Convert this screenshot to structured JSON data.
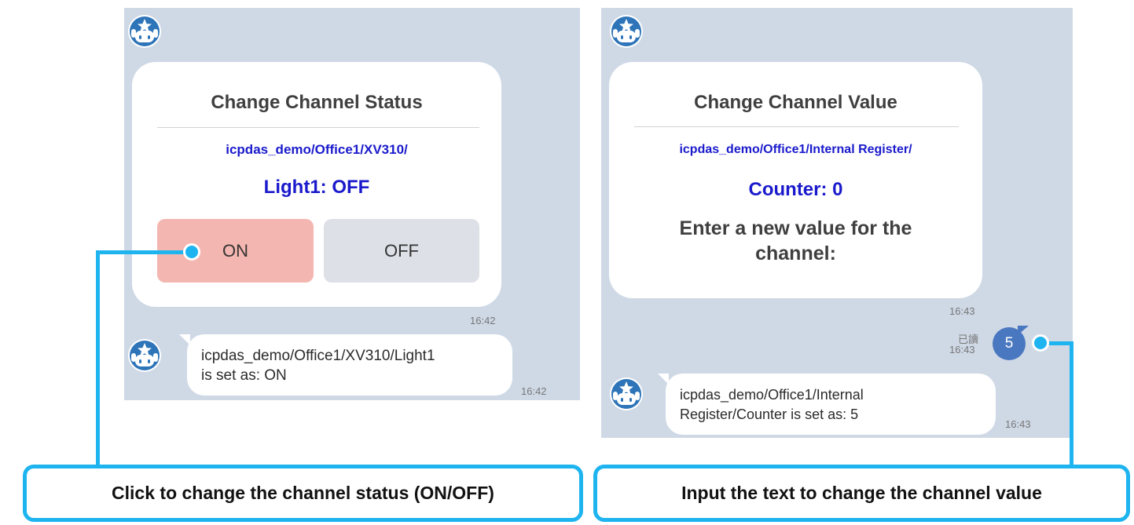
{
  "left_chat": {
    "card": {
      "title": "Change Channel Status",
      "path": "icpdas_demo/Office1/XV310/",
      "status": "Light1: OFF",
      "on_label": "ON",
      "off_label": "OFF",
      "time": "16:42"
    },
    "reply": {
      "text_line1": "icpdas_demo/Office1/XV310/Light1",
      "text_line2": "is set as: ON",
      "time": "16:42"
    }
  },
  "right_chat": {
    "card": {
      "title": "Change Channel Value",
      "path": "icpdas_demo/Office1/Internal Register/",
      "status": "Counter: 0",
      "prompt_line1": "Enter a new value for the",
      "prompt_line2": "channel:",
      "time": "16:43"
    },
    "user_message": {
      "read_label": "已讀",
      "time": "16:43",
      "text": "5"
    },
    "reply": {
      "text_line1": "icpdas_demo/Office1/Internal",
      "text_line2": "Register/Counter  is set as: 5",
      "time": "16:43"
    }
  },
  "callouts": {
    "left": "Click to change the channel status (ON/OFF)",
    "right": "Input the text to change the channel value"
  },
  "colors": {
    "accent": "#1eb4f0",
    "chat_background": "#cfd9e6",
    "on_button": "#f4b6b0",
    "off_button": "#dde0e6",
    "user_bubble": "#4a78c0",
    "link_blue": "#1a1acc"
  },
  "icons": {
    "bot_avatar": "robot-star-icon"
  }
}
